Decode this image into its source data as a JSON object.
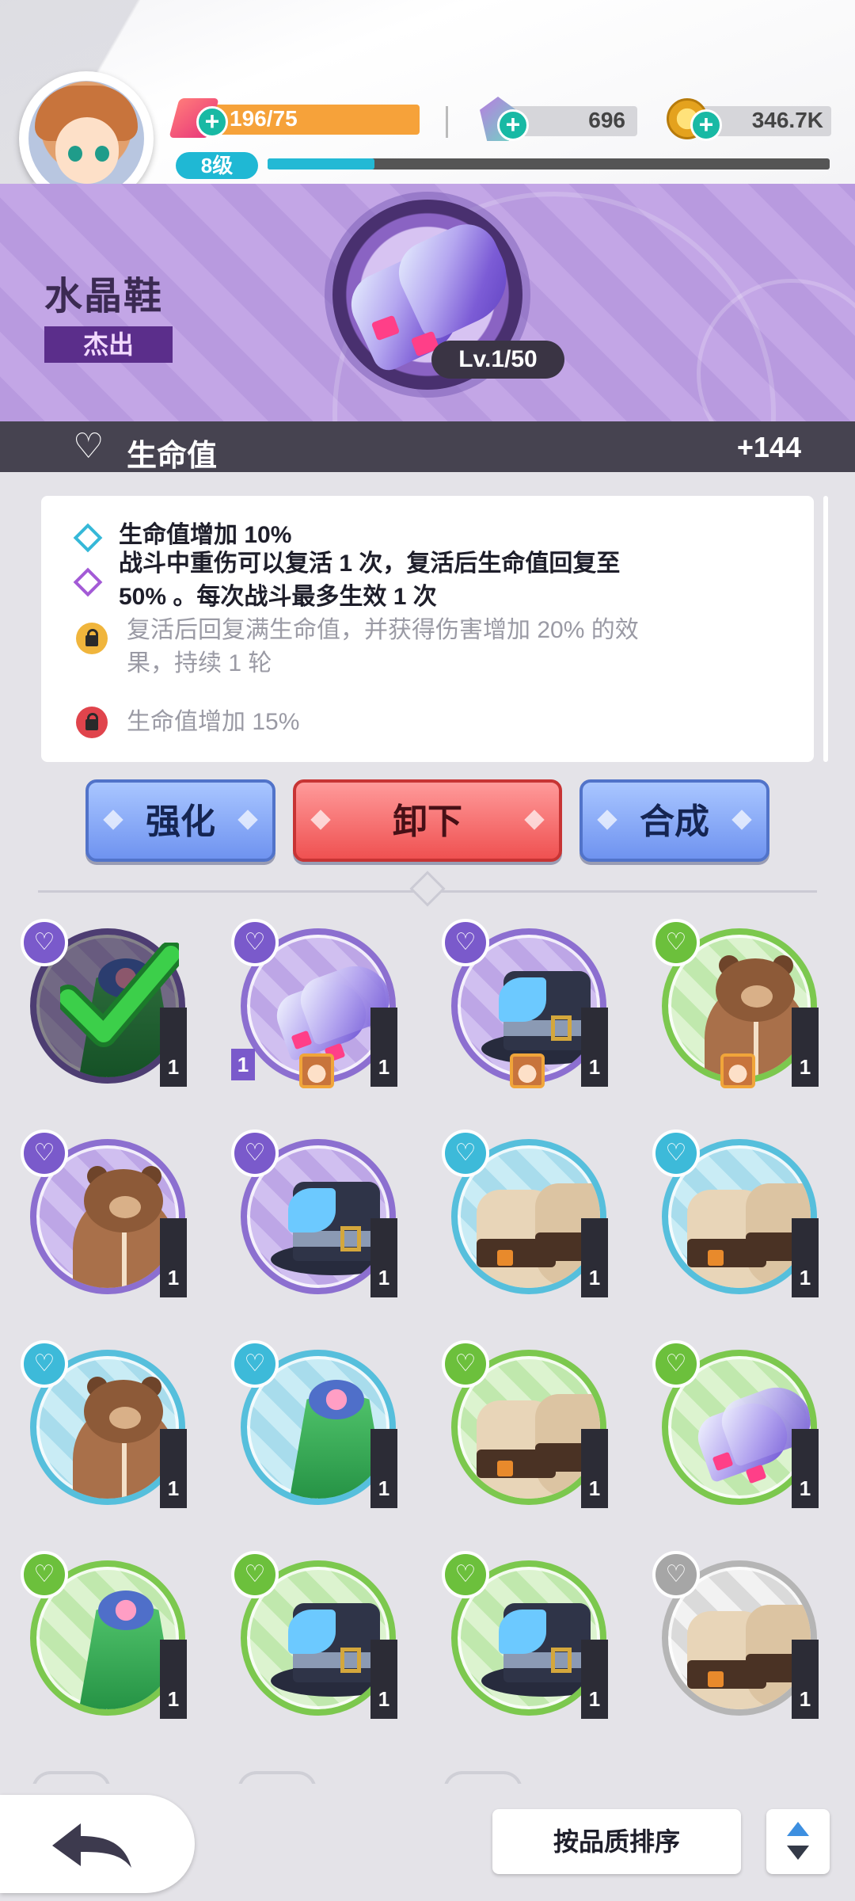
{
  "header": {
    "energy": "196/75",
    "gems": "696",
    "coins": "346.7K",
    "level": "8级",
    "exp_fraction": 0.19
  },
  "item": {
    "name": "水晶鞋",
    "rarity": "杰出",
    "level": "Lv.1/50"
  },
  "stat": {
    "label": "生命值",
    "value": "+144"
  },
  "effects": {
    "line1": "生命值增加 10%",
    "line2a": "战斗中重伤可以复活 1 次，复活后生命值回复至",
    "line2b": "50% 。每次战斗最多生效 1 次",
    "line3a": "复活后回复满生命值，并获得伤害增加 20% 的效",
    "line3b": "果，持续 1 轮",
    "line4": "生命值增加 15%"
  },
  "actions": {
    "enhance": "强化",
    "unequip": "卸下",
    "fuse": "合成"
  },
  "grid": [
    {
      "art": "cape",
      "quality": "purple",
      "count": "1",
      "equipped": true
    },
    {
      "art": "shoe",
      "quality": "purple",
      "count": "1",
      "left_count": "1",
      "owner": true
    },
    {
      "art": "hat",
      "quality": "purple",
      "count": "1",
      "owner": true
    },
    {
      "art": "bear",
      "quality": "green",
      "count": "1",
      "owner": true
    },
    {
      "art": "bear",
      "quality": "purple",
      "count": "1"
    },
    {
      "art": "hat",
      "quality": "purple",
      "count": "1"
    },
    {
      "art": "boot",
      "quality": "blue",
      "count": "1"
    },
    {
      "art": "boot",
      "quality": "blue",
      "count": "1"
    },
    {
      "art": "bear",
      "quality": "blue",
      "count": "1"
    },
    {
      "art": "cape",
      "quality": "blue",
      "count": "1"
    },
    {
      "art": "boot",
      "quality": "green",
      "count": "1"
    },
    {
      "art": "shoe",
      "quality": "green",
      "count": "1"
    },
    {
      "art": "cape",
      "quality": "green",
      "count": "1"
    },
    {
      "art": "hat",
      "quality": "green",
      "count": "1"
    },
    {
      "art": "hat",
      "quality": "green",
      "count": "1"
    },
    {
      "art": "boot",
      "quality": "gray",
      "count": "1"
    }
  ],
  "bottom": {
    "sort_label": "按品质排序"
  },
  "colors": {
    "banner": "#b79bdf",
    "energy": "#f6a23a",
    "accent": "#1fb8d4"
  }
}
